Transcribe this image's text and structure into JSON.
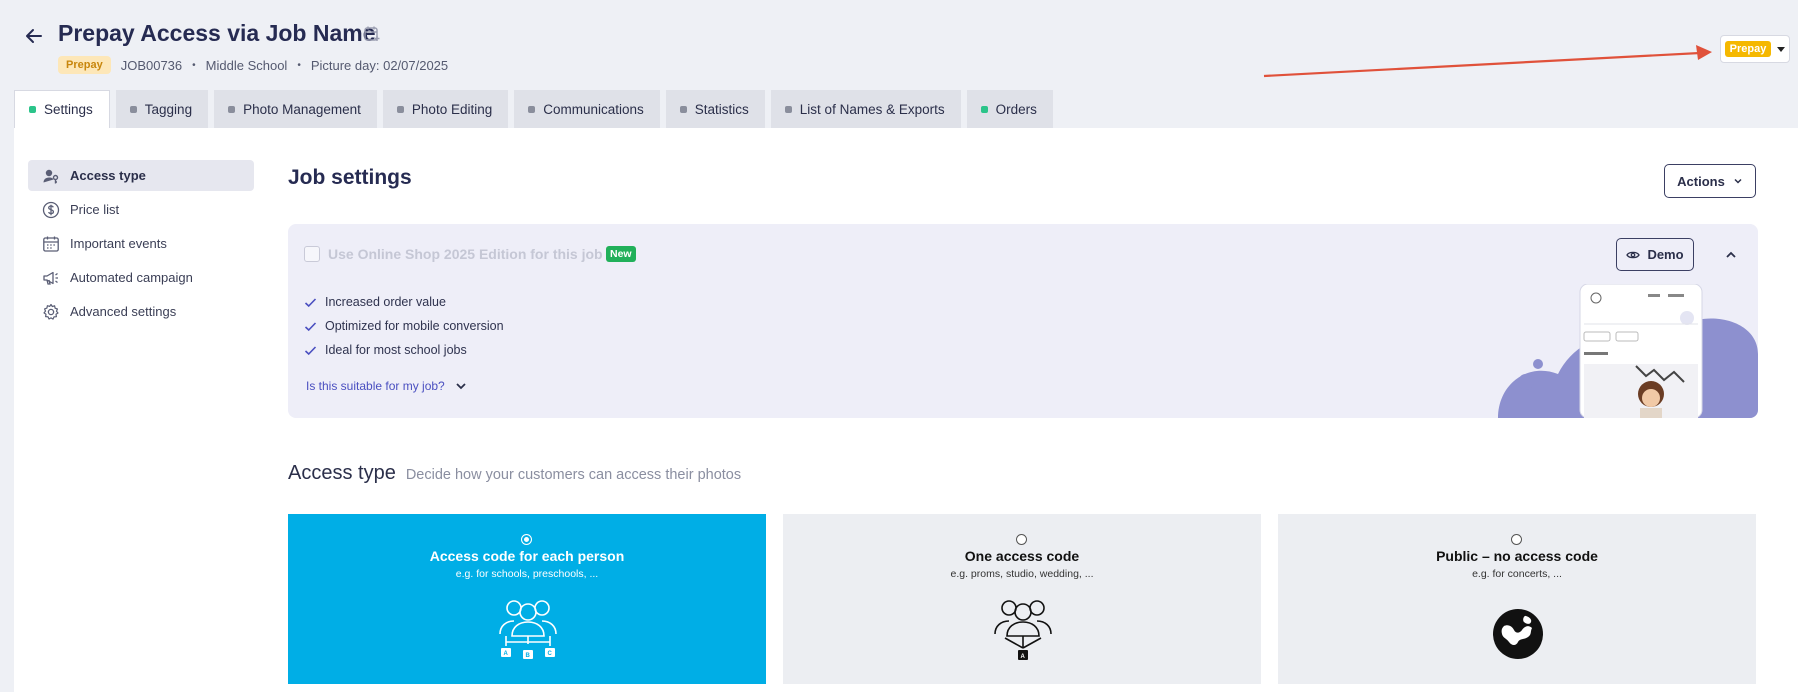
{
  "header": {
    "title": "Prepay Access via Job Name",
    "badge": "Prepay",
    "job_id": "JOB00736",
    "school": "Middle School",
    "picture_day": "Picture day: 02/07/2025",
    "separator": "•",
    "status": {
      "label": "Prepay",
      "color": "#f5b800"
    }
  },
  "tabs": [
    {
      "label": "Settings",
      "dot": "green",
      "active": true
    },
    {
      "label": "Tagging",
      "dot": "gray"
    },
    {
      "label": "Photo Management",
      "dot": "gray"
    },
    {
      "label": "Photo Editing",
      "dot": "gray"
    },
    {
      "label": "Communications",
      "dot": "gray"
    },
    {
      "label": "Statistics",
      "dot": "gray"
    },
    {
      "label": "List of Names & Exports",
      "dot": "gray"
    },
    {
      "label": "Orders",
      "dot": "green"
    }
  ],
  "sidebar": {
    "items": [
      {
        "label": "Access type",
        "icon": "user-key-icon",
        "active": true
      },
      {
        "label": "Price list",
        "icon": "dollar-circle-icon"
      },
      {
        "label": "Important events",
        "icon": "calendar-icon"
      },
      {
        "label": "Automated campaign",
        "icon": "megaphone-icon"
      },
      {
        "label": "Advanced settings",
        "icon": "gear-icon"
      }
    ]
  },
  "main": {
    "title": "Job settings",
    "actions_label": "Actions",
    "shop": {
      "title": "Use Online Shop 2025 Edition for this job",
      "new_badge": "New",
      "benefits": [
        "Increased order value",
        "Optimized for mobile conversion",
        "Ideal for most school jobs"
      ],
      "suitable_link": "Is this suitable for my job?",
      "demo_label": "Demo"
    },
    "access": {
      "heading": "Access type",
      "subheading": "Decide how your customers can access their photos",
      "options": [
        {
          "title": "Access code for each person",
          "subtitle": "e.g. for schools, preschools, ...",
          "selected": true
        },
        {
          "title": "One access code",
          "subtitle": "e.g. proms, studio, wedding, ..."
        },
        {
          "title": "Public – no access code",
          "subtitle": "e.g. for concerts, ..."
        }
      ]
    }
  },
  "colors": {
    "accent": "#00aee6",
    "title": "#262b52",
    "green": "#2bc48a",
    "annotation_arrow": "#e0513a"
  }
}
